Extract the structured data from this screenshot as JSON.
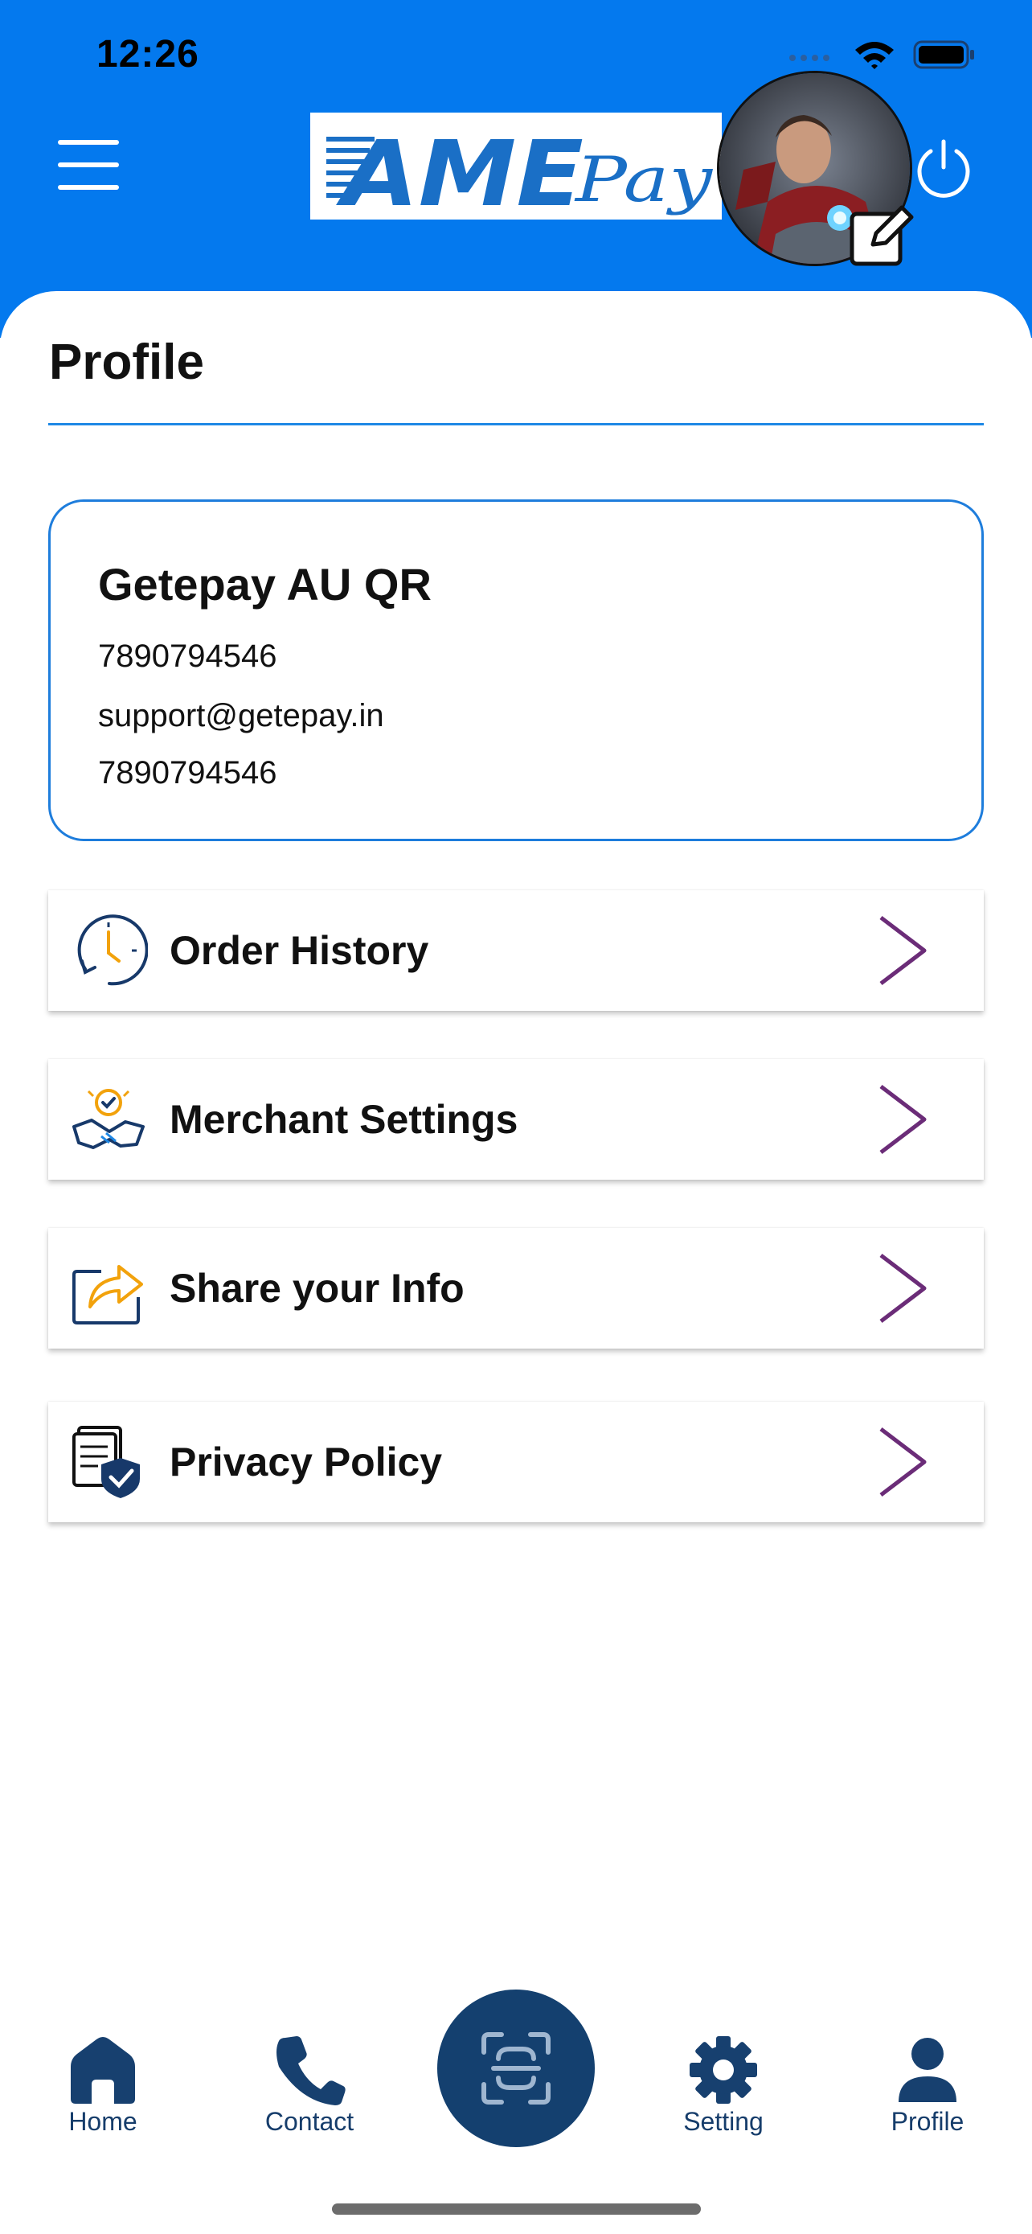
{
  "status_bar": {
    "time": "12:26"
  },
  "header": {
    "logo_text": "AME",
    "logo_script": "Pay",
    "colors": {
      "brand_blue": "#0479ee",
      "logo_blue": "#1a6fc6",
      "navy": "#14406f",
      "chevron": "#6b2c78"
    }
  },
  "page": {
    "title": "Profile"
  },
  "profile": {
    "name": "Getepay AU QR",
    "phone": "7890794546",
    "email": "support@getepay.in",
    "phone_alt": "7890794546"
  },
  "menu": [
    {
      "label": "Order History",
      "icon": "order-history-clock-icon"
    },
    {
      "label": "Merchant Settings",
      "icon": "merchant-handshake-icon"
    },
    {
      "label": "Share your Info",
      "icon": "share-icon"
    },
    {
      "label": "Privacy Policy",
      "icon": "privacy-shield-icon"
    }
  ],
  "tabbar": {
    "home": "Home",
    "contact": "Contact",
    "setting": "Setting",
    "profile": "Profile"
  }
}
